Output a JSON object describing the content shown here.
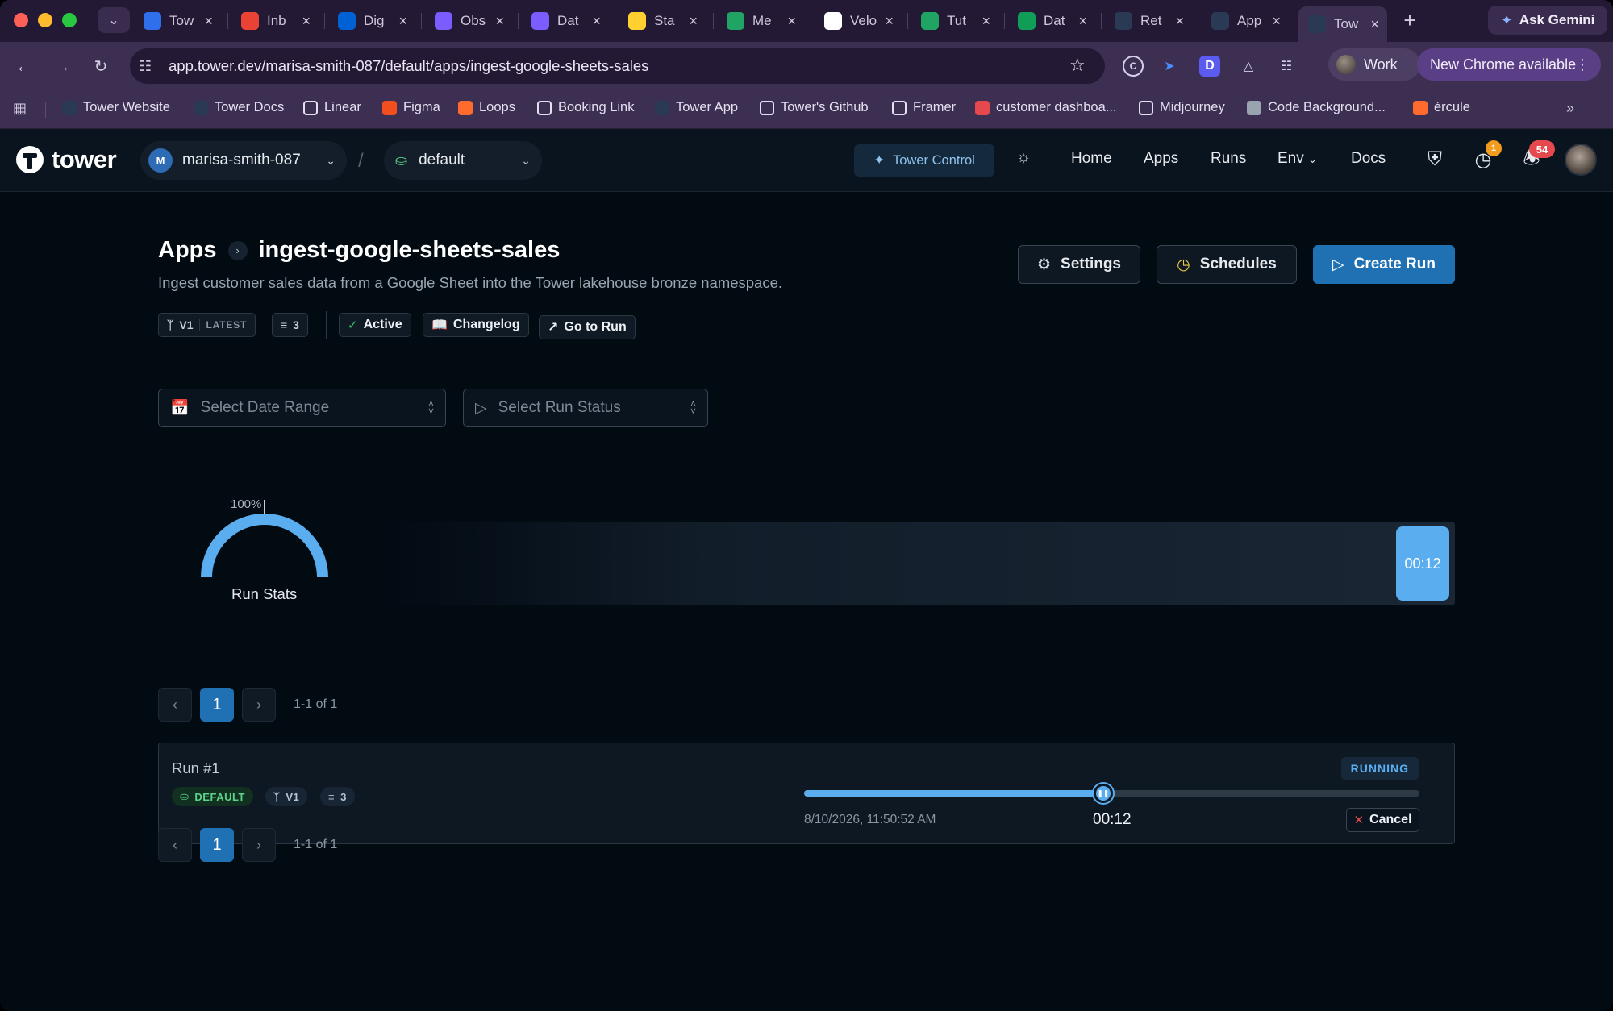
{
  "browser": {
    "tabs": [
      {
        "label": "Tow",
        "icon": "calendar-10-icon",
        "color": "#2f6fec"
      },
      {
        "label": "Inb",
        "icon": "gmail-icon",
        "color": "#ea4335"
      },
      {
        "label": "Dig",
        "icon": "box-icon",
        "color": "#0061d5"
      },
      {
        "label": "Obs",
        "icon": "app-icon",
        "color": "#7b5cff"
      },
      {
        "label": "Dat",
        "icon": "app-icon",
        "color": "#7b5cff"
      },
      {
        "label": "Sta",
        "icon": "miro-icon",
        "color": "#ffd02f"
      },
      {
        "label": "Me",
        "icon": "google-drive-icon",
        "color": "#1fa463"
      },
      {
        "label": "Velo",
        "icon": "github-icon",
        "color": "#ffffff"
      },
      {
        "label": "Tut",
        "icon": "google-drive-icon",
        "color": "#1fa463"
      },
      {
        "label": "Dat",
        "icon": "google-sheets-icon",
        "color": "#0f9d58"
      },
      {
        "label": "Ret",
        "icon": "tower-icon",
        "color": "#2a3a55"
      },
      {
        "label": "App",
        "icon": "tower-icon",
        "color": "#2a3a55"
      },
      {
        "label": "Tow",
        "icon": "tower-icon",
        "color": "#2a3a55"
      }
    ],
    "new_tab": "+",
    "ask_gemini": "Ask Gemini",
    "url": "app.tower.dev/marisa-smith-087/default/apps/ingest-google-sheets-sales",
    "profile": "Work",
    "update": "New Chrome available",
    "bookmarks": [
      {
        "label": "Tower Website",
        "icon": "tower-icon",
        "color": "#2a3a55"
      },
      {
        "label": "Tower Docs",
        "icon": "tower-icon",
        "color": "#2a3a55"
      },
      {
        "label": "Linear",
        "icon": "linear-icon",
        "color": "#ffffff"
      },
      {
        "label": "Figma",
        "icon": "figma-icon",
        "color": "#f24e1e"
      },
      {
        "label": "Loops",
        "icon": "loops-icon",
        "color": "#ff6b2c"
      },
      {
        "label": "Booking Link",
        "icon": "cal-icon",
        "color": "#ffffff"
      },
      {
        "label": "Tower App",
        "icon": "tower-icon",
        "color": "#2a3a55"
      },
      {
        "label": "Tower's Github",
        "icon": "github-icon",
        "color": "#ffffff"
      },
      {
        "label": "Framer",
        "icon": "framer-icon",
        "color": "#ffffff"
      },
      {
        "label": "customer dashboa...",
        "icon": "dashboard-icon",
        "color": "#e5484d"
      },
      {
        "label": "Midjourney",
        "icon": "midjourney-icon",
        "color": "#ffffff"
      },
      {
        "label": "Code Background...",
        "icon": "globe-icon",
        "color": "#9aa4b1"
      },
      {
        "label": "ércule",
        "icon": "ercule-icon",
        "color": "#ff6b2c"
      }
    ]
  },
  "app": {
    "brand": "tower",
    "org": {
      "initial": "M",
      "name": "marisa-smith-087"
    },
    "env": "default",
    "tower_control": "Tower Control",
    "nav": [
      "Home",
      "Apps",
      "Runs",
      "Env",
      "Docs"
    ],
    "notifications": {
      "clock_badge": "1",
      "bell_badge": "54"
    },
    "breadcrumb": {
      "root": "Apps",
      "current": "ingest-google-sheets-sales"
    },
    "description": "Ingest customer sales data from a Google Sheet into the Tower lakehouse bronze namespace.",
    "actions": {
      "settings": "Settings",
      "schedules": "Schedules",
      "create_run": "Create Run"
    },
    "tags": {
      "version": "V1",
      "latest": "LATEST",
      "params": "3",
      "status": "Active",
      "changelog": "Changelog",
      "go_to_run": "Go to Run"
    },
    "filters": {
      "date_placeholder": "Select Date Range",
      "status_placeholder": "Select Run Status"
    },
    "stats": {
      "percent": "100%",
      "percent_value": 100,
      "label": "Run Stats",
      "current_run_time": "00:12"
    },
    "pager": {
      "page": "1",
      "info": "1-1 of 1"
    },
    "runs": [
      {
        "title": "Run #1",
        "env": "DEFAULT",
        "version": "V1",
        "params": "3",
        "status": "RUNNING",
        "started": "8/10/2026, 11:50:52 AM",
        "elapsed": "00:12",
        "progress": 0.486,
        "cancel": "Cancel"
      }
    ]
  }
}
